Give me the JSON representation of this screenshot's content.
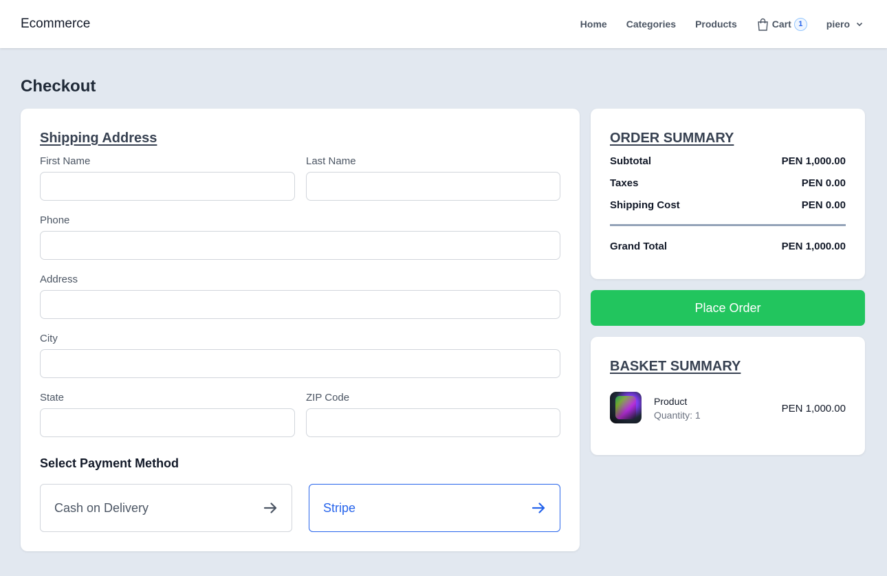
{
  "header": {
    "brand": "Ecommerce",
    "nav": {
      "home": "Home",
      "categories": "Categories",
      "products": "Products",
      "cart": "Cart",
      "cart_count": "1"
    },
    "user": "piero"
  },
  "page_title": "Checkout",
  "shipping": {
    "title": "Shipping Address",
    "first_name_label": "First Name",
    "first_name_value": "",
    "last_name_label": "Last Name",
    "last_name_value": "",
    "phone_label": "Phone",
    "phone_value": "",
    "address_label": "Address",
    "address_value": "",
    "city_label": "City",
    "city_value": "",
    "state_label": "State",
    "state_value": "",
    "zip_label": "ZIP Code",
    "zip_value": ""
  },
  "payment": {
    "title": "Select Payment Method",
    "options": [
      "Cash on Delivery",
      "Stripe"
    ],
    "selected": "Stripe"
  },
  "order_summary": {
    "title": "ORDER SUMMARY",
    "subtotal_label": "Subtotal",
    "subtotal_value": "PEN 1,000.00",
    "taxes_label": "Taxes",
    "taxes_value": "PEN 0.00",
    "shipping_label": "Shipping Cost",
    "shipping_value": "PEN 0.00",
    "grand_total_label": "Grand Total",
    "grand_total_value": "PEN 1,000.00"
  },
  "place_order_label": "Place Order",
  "basket": {
    "title": "BASKET SUMMARY",
    "items": [
      {
        "name": "Product",
        "quantity": "Quantity: 1",
        "price": "PEN 1,000.00"
      }
    ]
  },
  "colors": {
    "accent": "#2563eb",
    "success": "#22c55e",
    "background": "#e2e8f0"
  },
  "icons": {
    "cart": "shopping-bag-icon",
    "user_menu": "chevron-down-icon",
    "payment_option": "arrow-right-icon"
  }
}
